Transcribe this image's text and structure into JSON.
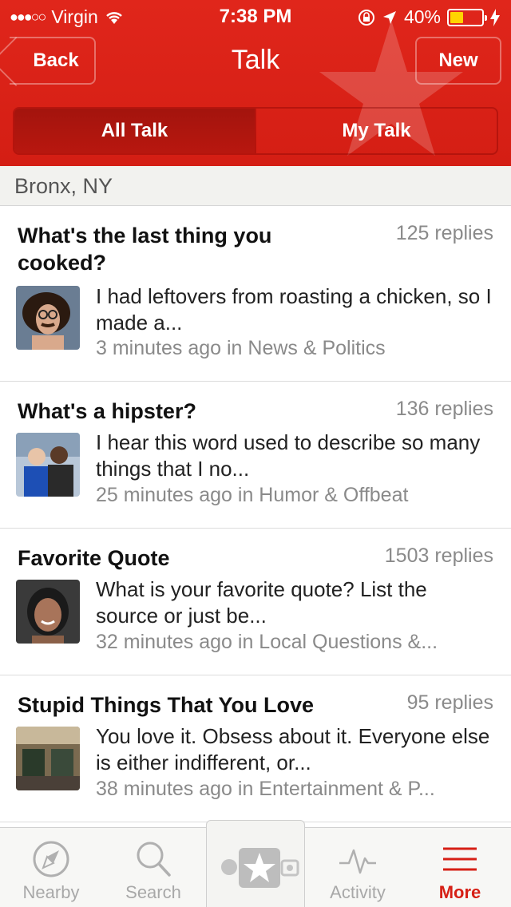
{
  "status_bar": {
    "carrier": "Virgin",
    "time": "7:38 PM",
    "battery": "40%"
  },
  "nav": {
    "back_label": "Back",
    "title": "Talk",
    "new_label": "New"
  },
  "segments": {
    "all": "All Talk",
    "mine": "My Talk"
  },
  "location": "Bronx, NY",
  "topics": [
    {
      "title": "What's the last thing you cooked?",
      "replies": "125 replies",
      "snippet": "I had leftovers from roasting a chicken, so I made a...",
      "meta": "3 minutes ago in News & Politics"
    },
    {
      "title": "What's a hipster?",
      "replies": "136 replies",
      "snippet": "I hear this word used to describe so many things that I no...",
      "meta": "25 minutes ago in Humor & Offbeat"
    },
    {
      "title": "Favorite Quote",
      "replies": "1503 replies",
      "snippet": "What is your favorite quote? List the source or just be...",
      "meta": "32 minutes ago in Local Questions &..."
    },
    {
      "title": "Stupid Things That You Love",
      "replies": "95 replies",
      "snippet": "You love it. Obsess about it. Everyone else is either indifferent, or...",
      "meta": "38 minutes ago in Entertainment & P..."
    }
  ],
  "tabs": {
    "nearby": "Nearby",
    "search": "Search",
    "activity": "Activity",
    "more": "More"
  },
  "colors": {
    "brand_red": "#d41e14",
    "active_tab": "#d61f15",
    "muted_text": "#8a8a8a"
  }
}
